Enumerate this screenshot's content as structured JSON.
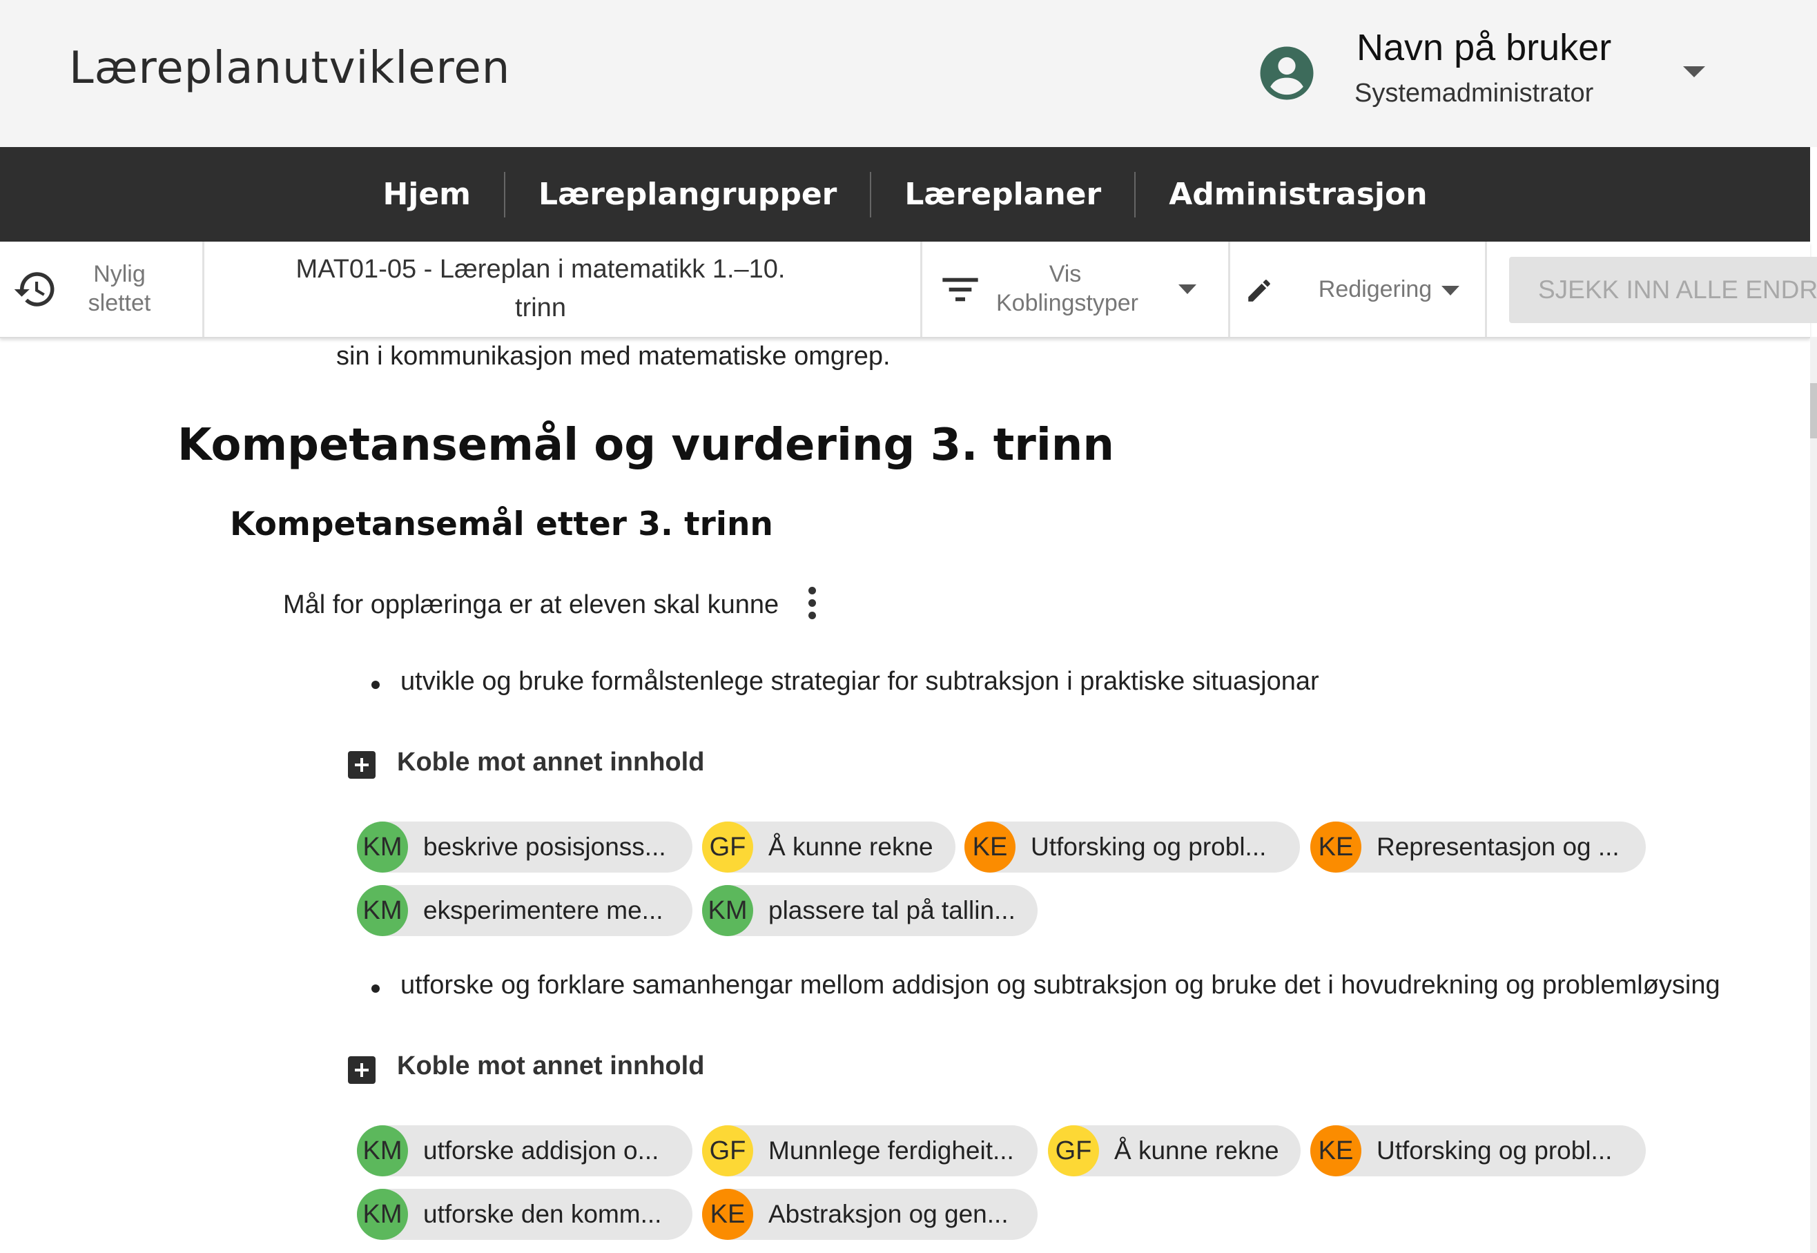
{
  "header": {
    "app_title": "Læreplanutvikleren",
    "user_name": "Navn på bruker",
    "user_role": "Systemadministrator"
  },
  "nav": {
    "items": [
      "Hjem",
      "Læreplangrupper",
      "Læreplaner",
      "Administrasjon"
    ]
  },
  "toolbar": {
    "recent_deleted_line1": "Nylig",
    "recent_deleted_line2": "slettet",
    "doc_title_line1": "MAT01-05 - Læreplan i matematikk 1.–10.",
    "doc_title_line2": "trinn",
    "filter_line1": "Vis",
    "filter_line2": "Koblingstyper",
    "edit_label": "Redigering",
    "checkin_label": "SJEKK INN ALLE ENDRINGER"
  },
  "content": {
    "prev_text": "sin i kommunikasjon med matematiske omgrep.",
    "heading1": "Kompetansemål og vurdering 3. trinn",
    "heading2": "Kompetansemål etter 3. trinn",
    "intro": "Mål for opplæringa er at eleven skal kunne",
    "goals": [
      {
        "text": "utvikle og bruke formålstenlege strategiar for subtraksjon i praktiske situasjonar",
        "link_label": "Koble mot annet innhold",
        "chips": [
          {
            "code": "KM",
            "label": "beskrive posisjonss..."
          },
          {
            "code": "GF",
            "label": "Å kunne rekne"
          },
          {
            "code": "KE",
            "label": "Utforsking og probl..."
          },
          {
            "code": "KE",
            "label": "Representasjon og ..."
          },
          {
            "code": "KM",
            "label": "eksperimentere me..."
          },
          {
            "code": "KM",
            "label": "plassere tal på tallin..."
          }
        ]
      },
      {
        "text": "utforske og forklare samanhengar mellom addisjon og subtraksjon og bruke det i hovudrekning og problemløysing",
        "link_label": "Koble mot annet innhold",
        "chips": [
          {
            "code": "KM",
            "label": "utforske addisjon o..."
          },
          {
            "code": "GF",
            "label": "Munnlege ferdigheit..."
          },
          {
            "code": "GF",
            "label": "Å kunne rekne"
          },
          {
            "code": "KE",
            "label": "Utforsking og probl..."
          },
          {
            "code": "KM",
            "label": "utforske den komm..."
          },
          {
            "code": "KE",
            "label": "Abstraksjon og gen..."
          }
        ]
      }
    ]
  },
  "colors": {
    "KM": "#5cb85c",
    "GF": "#fdd835",
    "KE": "#fb8c00",
    "nav_bg": "#2f2f2f",
    "user_icon": "#3d6b5b"
  },
  "icons": [
    "account-circle-icon",
    "dropdown-caret-icon",
    "history-icon",
    "filter-icon",
    "pencil-icon",
    "more-vert-icon",
    "add-box-icon"
  ]
}
